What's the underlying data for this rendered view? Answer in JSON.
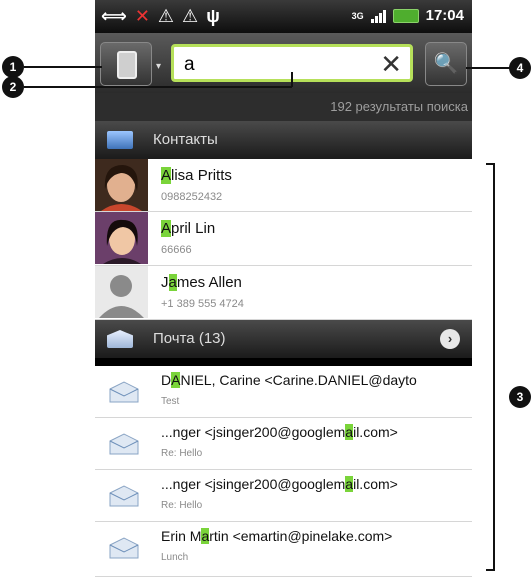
{
  "status": {
    "time": "17:04",
    "network": "3G"
  },
  "search": {
    "query": "a",
    "clear_icon": "clear-x-icon",
    "result_count_text": "192 результаты поиска"
  },
  "sections": {
    "contacts": {
      "label": "Контакты"
    },
    "mail": {
      "label": "Почта (13)"
    }
  },
  "contacts": [
    {
      "name_hl": "A",
      "name_rest": "lisa Pritts",
      "phone": "0988252432"
    },
    {
      "name_hl": "A",
      "name_rest": "pril Lin",
      "phone": "66666"
    },
    {
      "name_pre": "J",
      "name_hl": "a",
      "name_rest": "mes Allen",
      "phone": "+1 389 555 4724"
    }
  ],
  "mail": [
    {
      "pre": "D",
      "hl": "A",
      "rest": "NIEL, Carine <Carine.DANIEL@dayto",
      "subject": "Test"
    },
    {
      "pre": "...nger <jsinger200@googlem",
      "hl": "a",
      "rest": "il.com>",
      "subject": "Re: Hello"
    },
    {
      "pre": "...nger <jsinger200@googlem",
      "hl": "a",
      "rest": "il.com>",
      "subject": "Re: Hello"
    },
    {
      "pre": "Erin M",
      "hl": "a",
      "rest": "rtin <emartin@pinelake.com>",
      "subject": "Lunch"
    }
  ],
  "callouts": [
    "1",
    "2",
    "3",
    "4"
  ],
  "colors": {
    "highlight": "#7ad43a",
    "input_border": "#b6e05a"
  }
}
